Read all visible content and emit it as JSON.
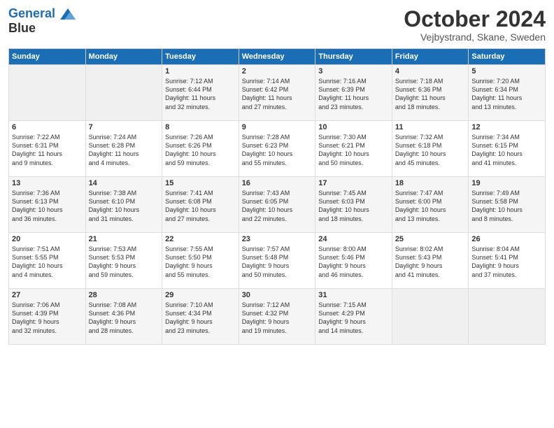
{
  "header": {
    "logo_line1": "General",
    "logo_line2": "Blue",
    "title": "October 2024",
    "location": "Vejbystrand, Skane, Sweden"
  },
  "days_of_week": [
    "Sunday",
    "Monday",
    "Tuesday",
    "Wednesday",
    "Thursday",
    "Friday",
    "Saturday"
  ],
  "weeks": [
    [
      {
        "num": "",
        "info": ""
      },
      {
        "num": "",
        "info": ""
      },
      {
        "num": "1",
        "info": "Sunrise: 7:12 AM\nSunset: 6:44 PM\nDaylight: 11 hours\nand 32 minutes."
      },
      {
        "num": "2",
        "info": "Sunrise: 7:14 AM\nSunset: 6:42 PM\nDaylight: 11 hours\nand 27 minutes."
      },
      {
        "num": "3",
        "info": "Sunrise: 7:16 AM\nSunset: 6:39 PM\nDaylight: 11 hours\nand 23 minutes."
      },
      {
        "num": "4",
        "info": "Sunrise: 7:18 AM\nSunset: 6:36 PM\nDaylight: 11 hours\nand 18 minutes."
      },
      {
        "num": "5",
        "info": "Sunrise: 7:20 AM\nSunset: 6:34 PM\nDaylight: 11 hours\nand 13 minutes."
      }
    ],
    [
      {
        "num": "6",
        "info": "Sunrise: 7:22 AM\nSunset: 6:31 PM\nDaylight: 11 hours\nand 9 minutes."
      },
      {
        "num": "7",
        "info": "Sunrise: 7:24 AM\nSunset: 6:28 PM\nDaylight: 11 hours\nand 4 minutes."
      },
      {
        "num": "8",
        "info": "Sunrise: 7:26 AM\nSunset: 6:26 PM\nDaylight: 10 hours\nand 59 minutes."
      },
      {
        "num": "9",
        "info": "Sunrise: 7:28 AM\nSunset: 6:23 PM\nDaylight: 10 hours\nand 55 minutes."
      },
      {
        "num": "10",
        "info": "Sunrise: 7:30 AM\nSunset: 6:21 PM\nDaylight: 10 hours\nand 50 minutes."
      },
      {
        "num": "11",
        "info": "Sunrise: 7:32 AM\nSunset: 6:18 PM\nDaylight: 10 hours\nand 45 minutes."
      },
      {
        "num": "12",
        "info": "Sunrise: 7:34 AM\nSunset: 6:15 PM\nDaylight: 10 hours\nand 41 minutes."
      }
    ],
    [
      {
        "num": "13",
        "info": "Sunrise: 7:36 AM\nSunset: 6:13 PM\nDaylight: 10 hours\nand 36 minutes."
      },
      {
        "num": "14",
        "info": "Sunrise: 7:38 AM\nSunset: 6:10 PM\nDaylight: 10 hours\nand 31 minutes."
      },
      {
        "num": "15",
        "info": "Sunrise: 7:41 AM\nSunset: 6:08 PM\nDaylight: 10 hours\nand 27 minutes."
      },
      {
        "num": "16",
        "info": "Sunrise: 7:43 AM\nSunset: 6:05 PM\nDaylight: 10 hours\nand 22 minutes."
      },
      {
        "num": "17",
        "info": "Sunrise: 7:45 AM\nSunset: 6:03 PM\nDaylight: 10 hours\nand 18 minutes."
      },
      {
        "num": "18",
        "info": "Sunrise: 7:47 AM\nSunset: 6:00 PM\nDaylight: 10 hours\nand 13 minutes."
      },
      {
        "num": "19",
        "info": "Sunrise: 7:49 AM\nSunset: 5:58 PM\nDaylight: 10 hours\nand 8 minutes."
      }
    ],
    [
      {
        "num": "20",
        "info": "Sunrise: 7:51 AM\nSunset: 5:55 PM\nDaylight: 10 hours\nand 4 minutes."
      },
      {
        "num": "21",
        "info": "Sunrise: 7:53 AM\nSunset: 5:53 PM\nDaylight: 9 hours\nand 59 minutes."
      },
      {
        "num": "22",
        "info": "Sunrise: 7:55 AM\nSunset: 5:50 PM\nDaylight: 9 hours\nand 55 minutes."
      },
      {
        "num": "23",
        "info": "Sunrise: 7:57 AM\nSunset: 5:48 PM\nDaylight: 9 hours\nand 50 minutes."
      },
      {
        "num": "24",
        "info": "Sunrise: 8:00 AM\nSunset: 5:46 PM\nDaylight: 9 hours\nand 46 minutes."
      },
      {
        "num": "25",
        "info": "Sunrise: 8:02 AM\nSunset: 5:43 PM\nDaylight: 9 hours\nand 41 minutes."
      },
      {
        "num": "26",
        "info": "Sunrise: 8:04 AM\nSunset: 5:41 PM\nDaylight: 9 hours\nand 37 minutes."
      }
    ],
    [
      {
        "num": "27",
        "info": "Sunrise: 7:06 AM\nSunset: 4:39 PM\nDaylight: 9 hours\nand 32 minutes."
      },
      {
        "num": "28",
        "info": "Sunrise: 7:08 AM\nSunset: 4:36 PM\nDaylight: 9 hours\nand 28 minutes."
      },
      {
        "num": "29",
        "info": "Sunrise: 7:10 AM\nSunset: 4:34 PM\nDaylight: 9 hours\nand 23 minutes."
      },
      {
        "num": "30",
        "info": "Sunrise: 7:12 AM\nSunset: 4:32 PM\nDaylight: 9 hours\nand 19 minutes."
      },
      {
        "num": "31",
        "info": "Sunrise: 7:15 AM\nSunset: 4:29 PM\nDaylight: 9 hours\nand 14 minutes."
      },
      {
        "num": "",
        "info": ""
      },
      {
        "num": "",
        "info": ""
      }
    ]
  ]
}
